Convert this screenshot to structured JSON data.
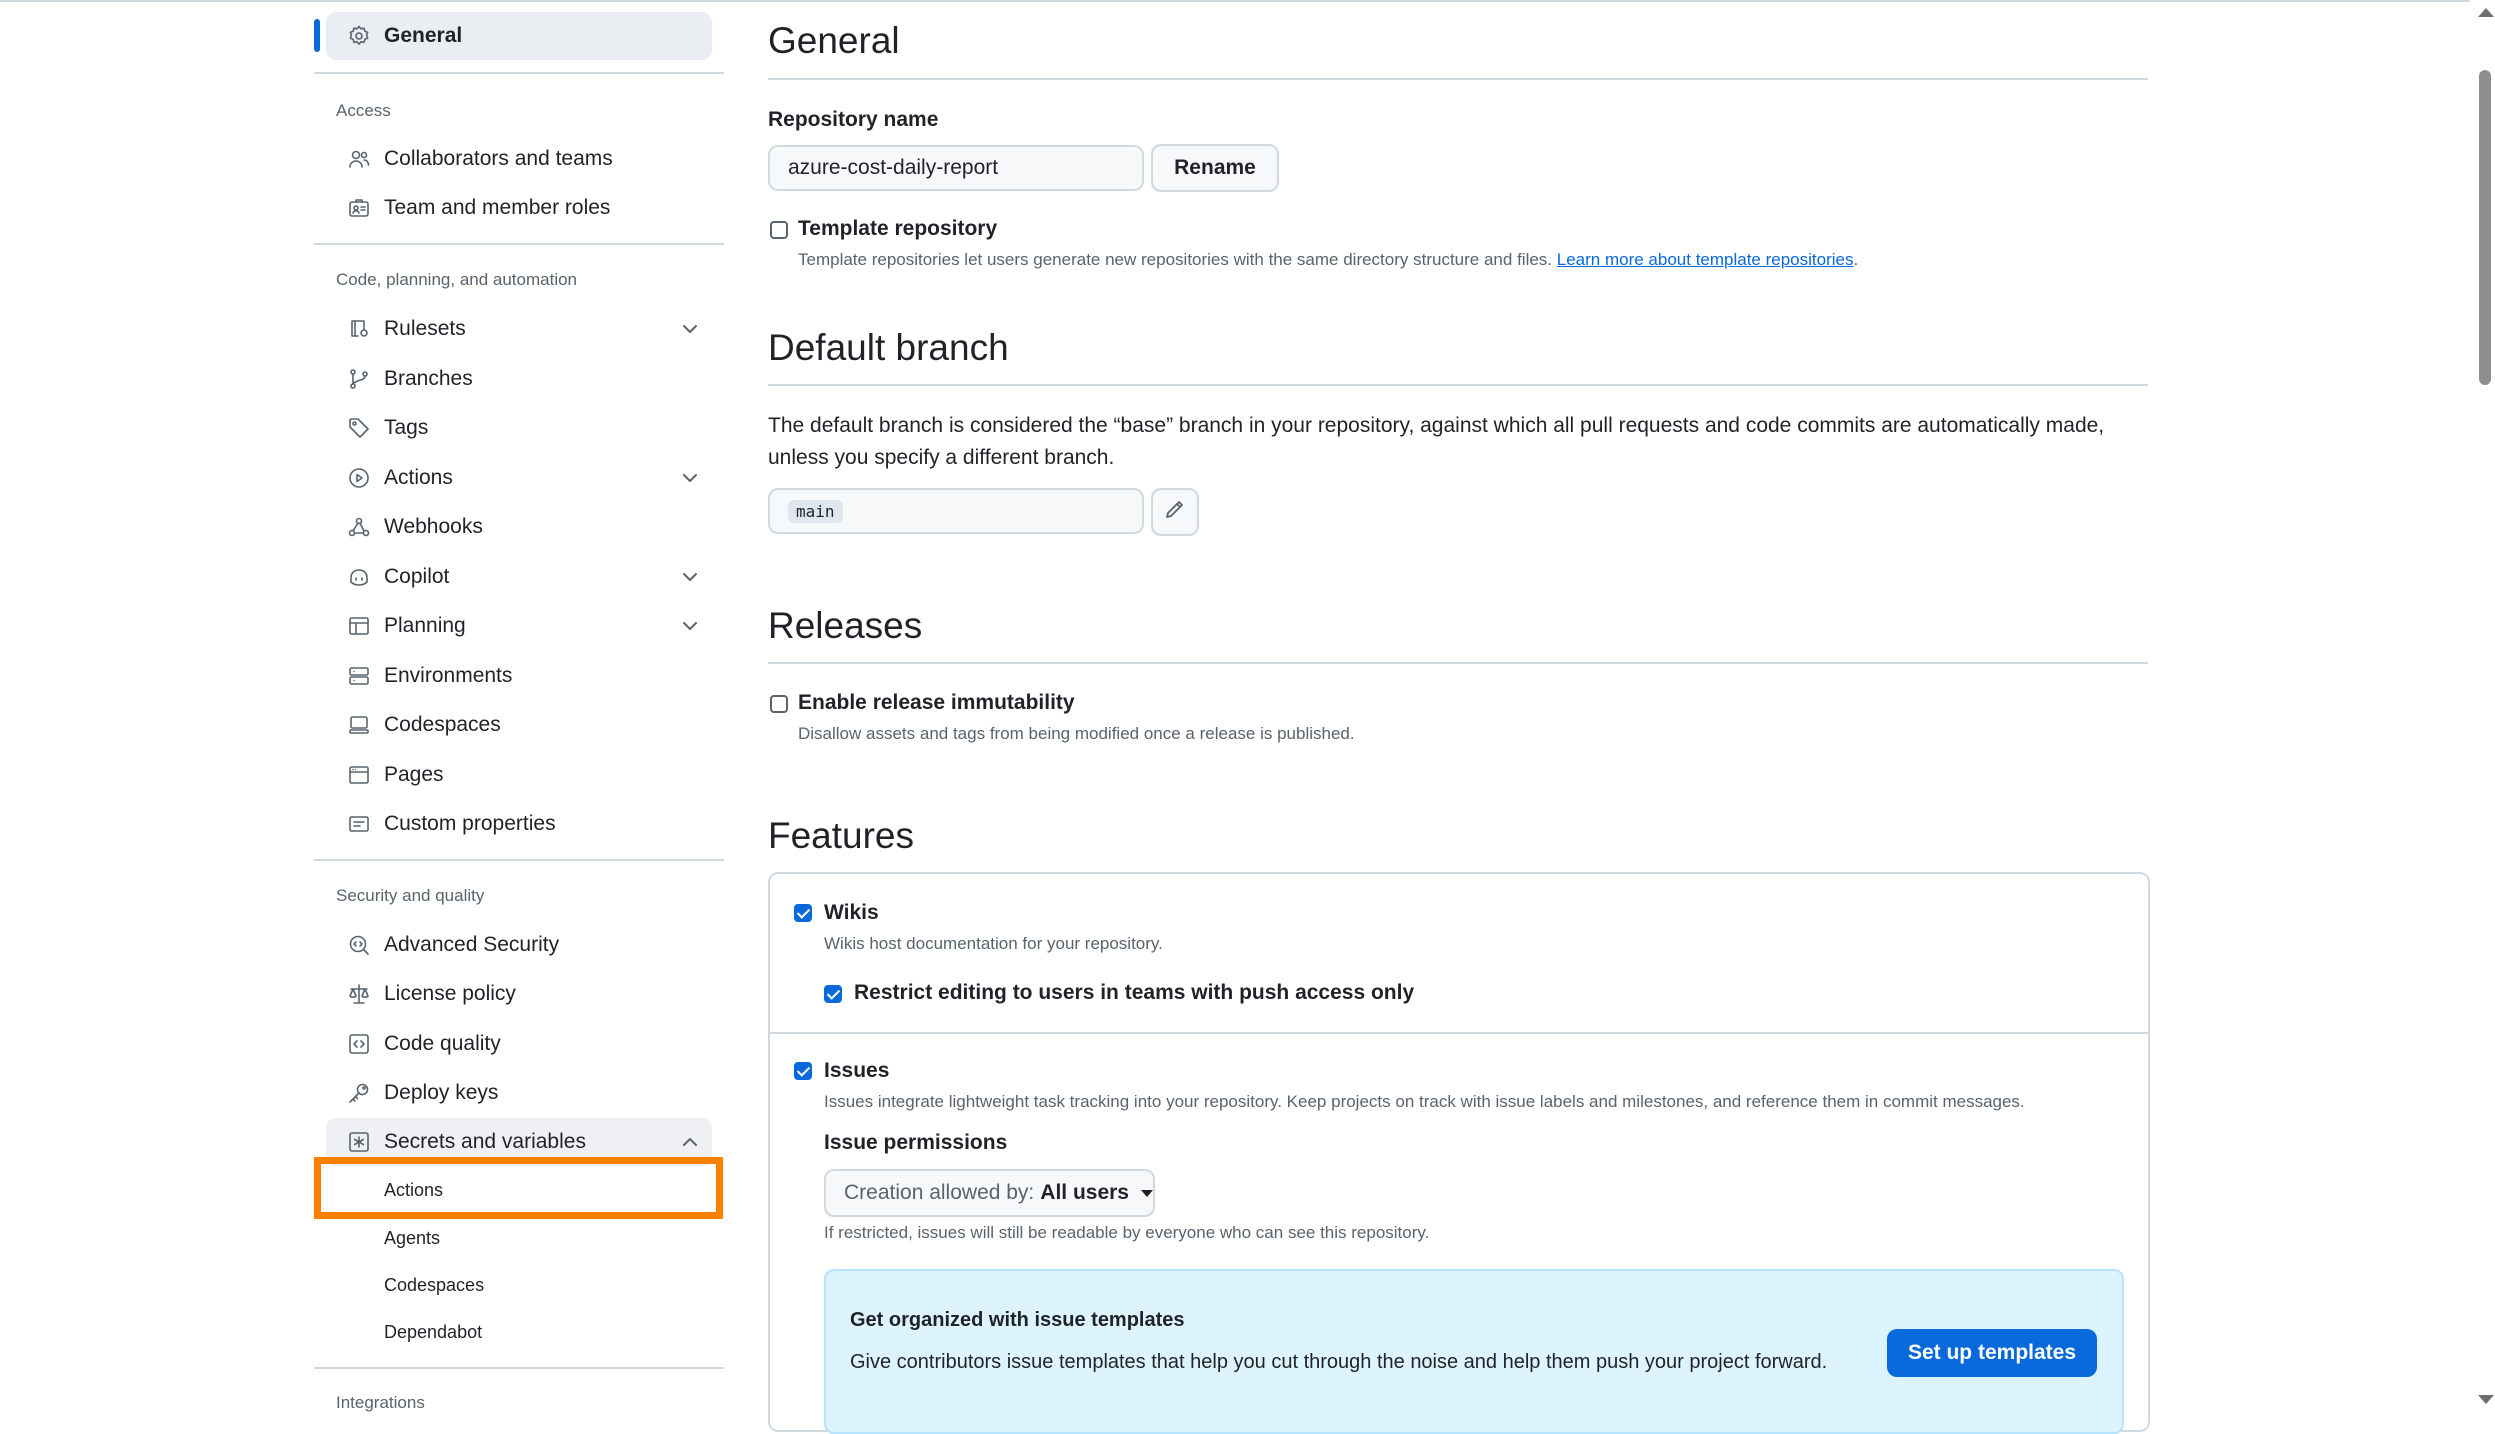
{
  "sidebar": {
    "general": "General",
    "access_heading": "Access",
    "access_items": [
      "Collaborators and teams",
      "Team and member roles"
    ],
    "code_heading": "Code, planning, and automation",
    "code_items": [
      "Rulesets",
      "Branches",
      "Tags",
      "Actions",
      "Webhooks",
      "Copilot",
      "Planning",
      "Environments",
      "Codespaces",
      "Pages",
      "Custom properties"
    ],
    "security_heading": "Security and quality",
    "security_items": [
      "Advanced Security",
      "License policy",
      "Code quality",
      "Deploy keys",
      "Secrets and variables"
    ],
    "secrets_subitems": [
      "Actions",
      "Agents",
      "Codespaces",
      "Dependabot"
    ],
    "integrations_heading": "Integrations"
  },
  "general": {
    "title": "General",
    "repo_name_label": "Repository name",
    "repo_name_value": "azure-cost-daily-report",
    "rename_button": "Rename",
    "template_label": "Template repository",
    "template_note": "Template repositories let users generate new repositories with the same directory structure and files.",
    "template_link": "Learn more about template repositories",
    "template_link_suffix": ".",
    "template_checked": false
  },
  "default_branch": {
    "title": "Default branch",
    "description": "The default branch is considered the “base” branch in your repository, against which all pull requests and code commits are automatically made, unless you specify a different branch.",
    "branch": "main"
  },
  "releases": {
    "title": "Releases",
    "immutability_label": "Enable release immutability",
    "immutability_note": "Disallow assets and tags from being modified once a release is published.",
    "immutability_checked": false
  },
  "features": {
    "title": "Features",
    "wikis_label": "Wikis",
    "wikis_note": "Wikis host documentation for your repository.",
    "wikis_checked": true,
    "restrict_label": "Restrict editing to users in teams with push access only",
    "restrict_checked": true,
    "issues_label": "Issues",
    "issues_note": "Issues integrate lightweight task tracking into your repository. Keep projects on track with issue labels and milestones, and reference them in commit messages.",
    "issues_checked": true,
    "issue_permissions_label": "Issue permissions",
    "creation_prefix": "Creation allowed by:",
    "creation_value": "All users",
    "restricted_note": "If restricted, issues will still be readable by everyone who can see this repository.",
    "callout_title": "Get organized with issue templates",
    "callout_text": "Give contributors issue templates that help you cut through the noise and help them push your project forward.",
    "setup_button": "Set up templates"
  },
  "colors": {
    "accent": "#0969da",
    "highlight": "#ff7f00"
  }
}
